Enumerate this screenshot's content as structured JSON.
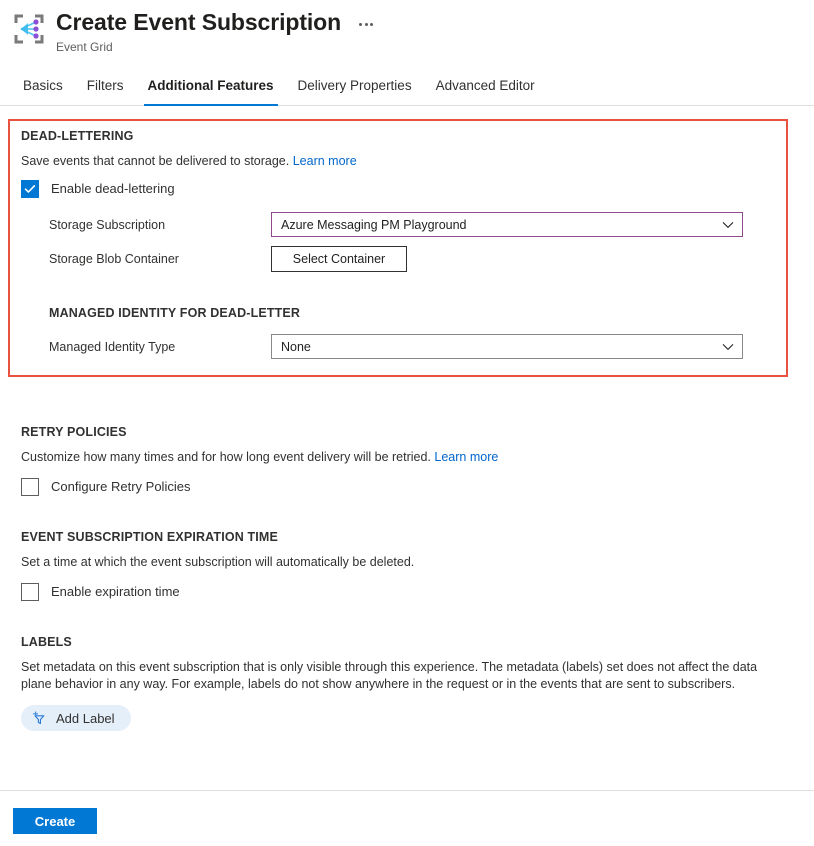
{
  "header": {
    "icon_name": "event-grid-icon",
    "title": "Create Event Subscription",
    "subtitle": "Event Grid",
    "more_menu_label": "More"
  },
  "tabs": [
    {
      "label": "Basics",
      "active": false
    },
    {
      "label": "Filters",
      "active": false
    },
    {
      "label": "Additional Features",
      "active": true
    },
    {
      "label": "Delivery Properties",
      "active": false
    },
    {
      "label": "Advanced Editor",
      "active": false
    }
  ],
  "dead_lettering": {
    "title": "DEAD-LETTERING",
    "description": "Save events that cannot be delivered to storage.",
    "learn_more": "Learn more",
    "enable_checkbox_label": "Enable dead-lettering",
    "enable_checked": true,
    "storage_subscription_label": "Storage Subscription",
    "storage_subscription_value": "Azure Messaging PM Playground",
    "storage_blob_container_label": "Storage Blob Container",
    "select_container_button": "Select Container",
    "managed_identity_title": "MANAGED IDENTITY FOR DEAD-LETTER",
    "managed_identity_type_label": "Managed Identity Type",
    "managed_identity_type_value": "None"
  },
  "retry_policies": {
    "title": "RETRY POLICIES",
    "description": "Customize how many times and for how long event delivery will be retried.",
    "learn_more": "Learn more",
    "checkbox_label": "Configure Retry Policies",
    "checked": false
  },
  "expiration": {
    "title": "EVENT SUBSCRIPTION EXPIRATION TIME",
    "description": "Set a time at which the event subscription will automatically be deleted.",
    "checkbox_label": "Enable expiration time",
    "checked": false
  },
  "labels": {
    "title": "LABELS",
    "description": "Set metadata on this event subscription that is only visible through this experience. The metadata (labels) set does not affect the data plane behavior in any way. For example, labels do not show anywhere in the request or in the events that are sent to subscribers.",
    "add_label_button": "Add Label",
    "add_label_icon": "add-filter-icon"
  },
  "footer": {
    "create_button": "Create"
  },
  "colors": {
    "accent": "#0078d4",
    "link": "#0066cc",
    "highlight_box": "#e8523f",
    "focused_field_border": "#8f4a8b",
    "pill_background": "#e5eff9"
  }
}
